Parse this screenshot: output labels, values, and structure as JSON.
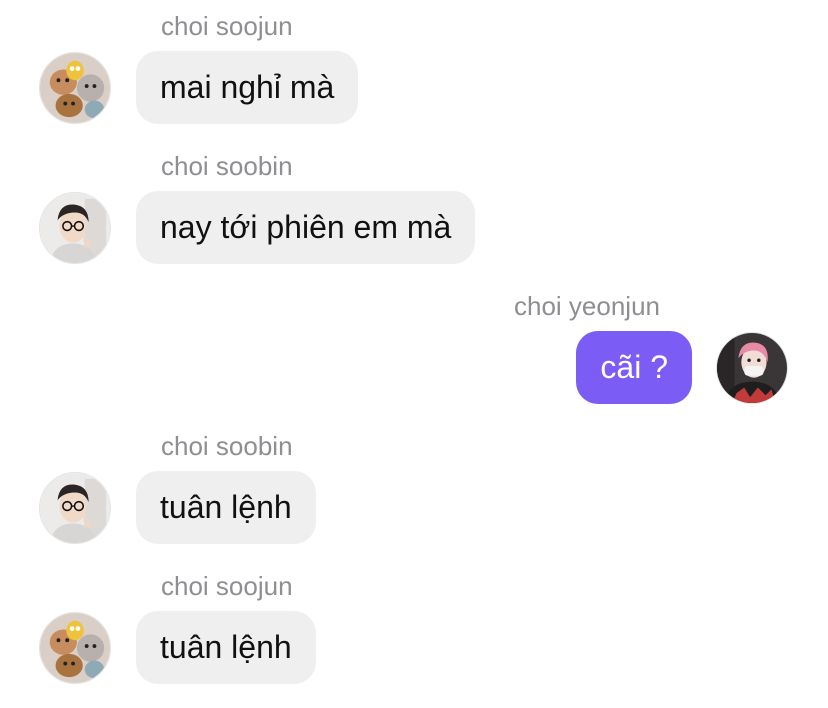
{
  "messages": [
    {
      "sender": "choi soojun",
      "text": "mai nghỉ mà",
      "direction": "incoming",
      "avatar_icon": "plush-toys-avatar-icon"
    },
    {
      "sender": "choi soobin",
      "text": "nay tới phiên em mà",
      "direction": "incoming",
      "avatar_icon": "glasses-person-avatar-icon"
    },
    {
      "sender": "choi yeonjun",
      "text": "cãi ?",
      "direction": "outgoing",
      "avatar_icon": "pink-hair-person-avatar-icon"
    },
    {
      "sender": "choi soobin",
      "text": "tuân lệnh",
      "direction": "incoming",
      "avatar_icon": "glasses-person-avatar-icon"
    },
    {
      "sender": "choi soojun",
      "text": "tuân lệnh",
      "direction": "incoming",
      "avatar_icon": "plush-toys-avatar-icon"
    }
  ],
  "colors": {
    "incoming_bubble": "#efeff0",
    "outgoing_bubble": "#7b5cf5",
    "sender_name": "#8e8e93"
  }
}
